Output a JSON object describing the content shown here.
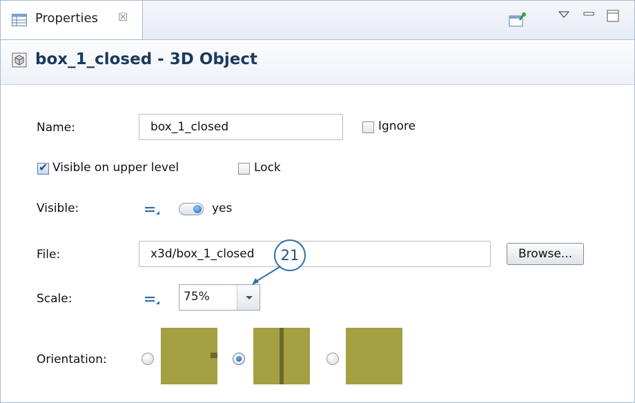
{
  "tab": {
    "label": "Properties",
    "close": "☒"
  },
  "header": {
    "title": "box_1_closed - 3D Object"
  },
  "form": {
    "name_label": "Name:",
    "name_value": "box_1_closed",
    "ignore_label": "Ignore",
    "ignore_checked": false,
    "visible_upper_label": "Visible on upper level",
    "visible_upper_checked": true,
    "lock_label": "Lock",
    "lock_checked": false,
    "visible_label": "Visible:",
    "visible_value": "yes",
    "file_label": "File:",
    "file_value": "x3d/box_1_closed",
    "browse_label": "Browse...",
    "scale_label": "Scale:",
    "scale_value": "75%",
    "orientation_label": "Orientation:",
    "orientation_selected": 2
  },
  "callout": {
    "number": "21"
  },
  "colors": {
    "accent": "#2e6ea8",
    "title": "#1b3a5e",
    "swatch": "#a59f43",
    "swatch_line": "#6c6a2b"
  }
}
